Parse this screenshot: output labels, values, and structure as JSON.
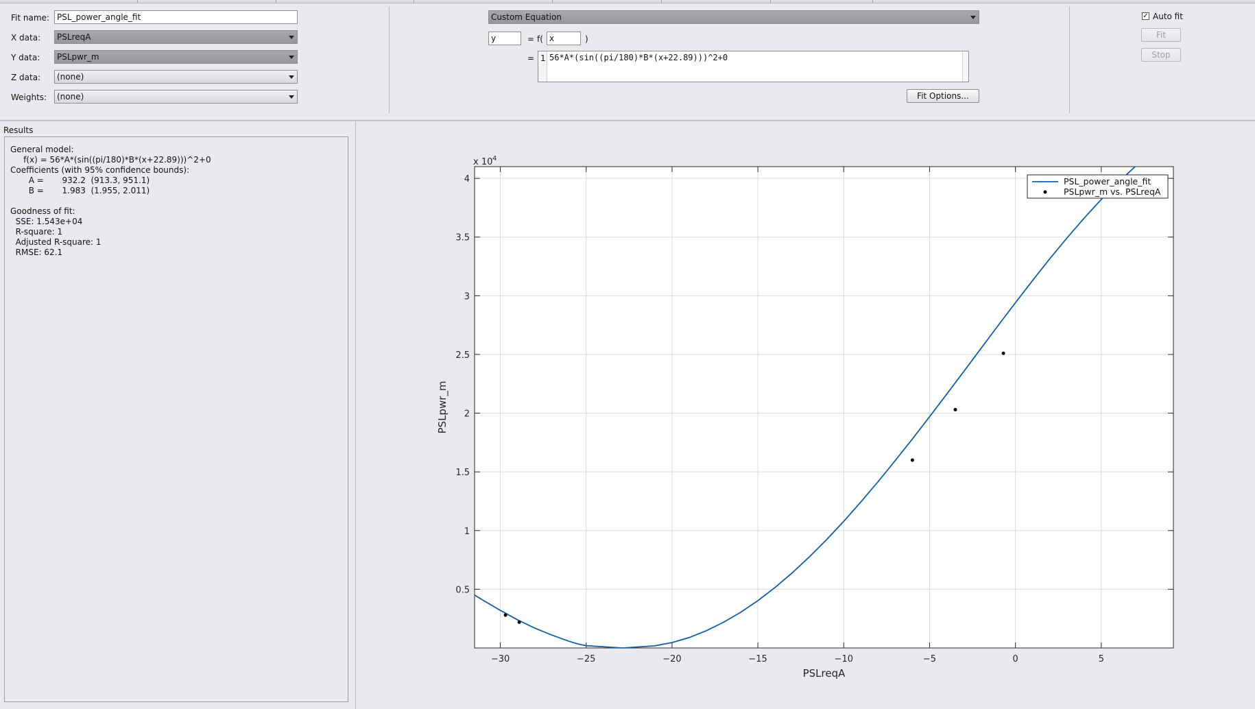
{
  "settings": {
    "fit_name_label": "Fit name:",
    "fit_name_value": "PSL_power_angle_fit",
    "x_data_label": "X data:",
    "x_data_value": "PSLreqA",
    "y_data_label": "Y data:",
    "y_data_value": "PSLpwr_m",
    "z_data_label": "Z data:",
    "z_data_value": "(none)",
    "weights_label": "Weights:",
    "weights_value": "(none)"
  },
  "equation": {
    "type_value": "Custom Equation",
    "dependent_var": "y",
    "equals": "=",
    "f_open": "f(",
    "independent_var": "x",
    "f_close": ")",
    "line_number": "1",
    "expression": "56*A*(sin((pi/180)*B*(x+22.89)))^2+0",
    "fit_options_label": "Fit Options..."
  },
  "controls": {
    "auto_fit_label": "Auto fit",
    "auto_fit_checked": true,
    "fit_label": "Fit",
    "stop_label": "Stop"
  },
  "results": {
    "title": "Results",
    "lines": [
      "General model:",
      "     f(x) = 56*A*(sin((pi/180)*B*(x+22.89)))^2+0",
      "Coefficients (with 95% confidence bounds):",
      "       A =       932.2  (913.3, 951.1)",
      "       B =       1.983  (1.955, 2.011)",
      "",
      "Goodness of fit:",
      "  SSE: 1.543e+04",
      "  R-square: 1",
      "  Adjusted R-square: 1",
      "  RMSE: 62.1"
    ]
  },
  "chart_data": {
    "type": "line",
    "xlabel": "PSLreqA",
    "ylabel": "PSLpwr_m",
    "y_exponent_label": "x 10",
    "y_exponent_power": "4",
    "xlim": [
      -31.5,
      9.2
    ],
    "ylim": [
      0,
      4.1
    ],
    "x_ticks": [
      -30,
      -25,
      -20,
      -15,
      -10,
      -5,
      0,
      5
    ],
    "x_tick_labels": [
      "−30",
      "−25",
      "−20",
      "−15",
      "−10",
      "−5",
      "0",
      "5"
    ],
    "y_ticks": [
      0.5,
      1,
      1.5,
      2,
      2.5,
      3,
      3.5,
      4
    ],
    "y_tick_labels": [
      "0.5",
      "1",
      "1.5",
      "2",
      "2.5",
      "3",
      "3.5",
      "4"
    ],
    "grid": true,
    "legend_position": "top-right",
    "series": [
      {
        "name": "PSL_power_angle_fit",
        "kind": "line",
        "color": "#0f5ea8",
        "x": [
          -31.5,
          -31,
          -30,
          -29,
          -28,
          -27,
          -26,
          -25.5,
          -25,
          -22.89,
          -21,
          -20,
          -19,
          -18,
          -17,
          -16,
          -15,
          -14,
          -13,
          -12,
          -11,
          -10,
          -9,
          -8,
          -7,
          -6,
          -5,
          -4,
          -3,
          -2,
          -1,
          0,
          1,
          2,
          3,
          4,
          5,
          6,
          7,
          8,
          9.2
        ],
        "y": [
          0.451,
          0.406,
          0.32,
          0.24,
          0.17,
          0.11,
          0.057,
          0.035,
          0.019,
          0,
          0.018,
          0.046,
          0.089,
          0.147,
          0.219,
          0.304,
          0.403,
          0.515,
          0.64,
          0.776,
          0.923,
          1.079,
          1.244,
          1.417,
          1.596,
          1.78,
          1.97,
          2.162,
          2.357,
          2.553,
          2.748,
          2.941,
          3.13,
          3.315,
          3.492,
          3.661,
          3.82,
          3.968,
          4.104,
          4.225,
          4.35
        ]
      },
      {
        "name": "PSLpwr_m vs. PSLreqA",
        "kind": "scatter",
        "color": "#000000",
        "x": [
          -29.7,
          -28.9,
          -6.0,
          -3.5,
          -0.7
        ],
        "y": [
          0.28,
          0.22,
          1.6,
          2.03,
          2.51
        ]
      }
    ]
  }
}
